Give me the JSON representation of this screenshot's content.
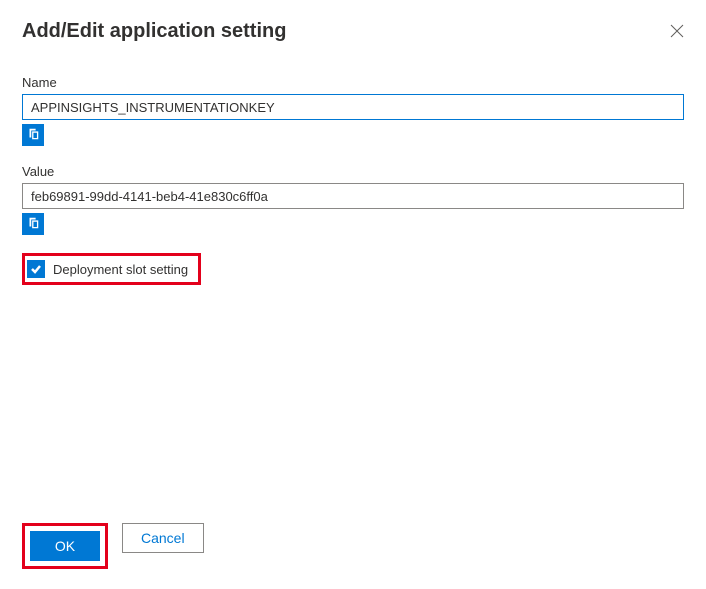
{
  "title": "Add/Edit application setting",
  "fields": {
    "name": {
      "label": "Name",
      "value": "APPINSIGHTS_INSTRUMENTATIONKEY"
    },
    "value": {
      "label": "Value",
      "value": "feb69891-99dd-4141-beb4-41e830c6ff0a"
    }
  },
  "checkbox": {
    "label": "Deployment slot setting",
    "checked": true
  },
  "buttons": {
    "ok": "OK",
    "cancel": "Cancel"
  }
}
